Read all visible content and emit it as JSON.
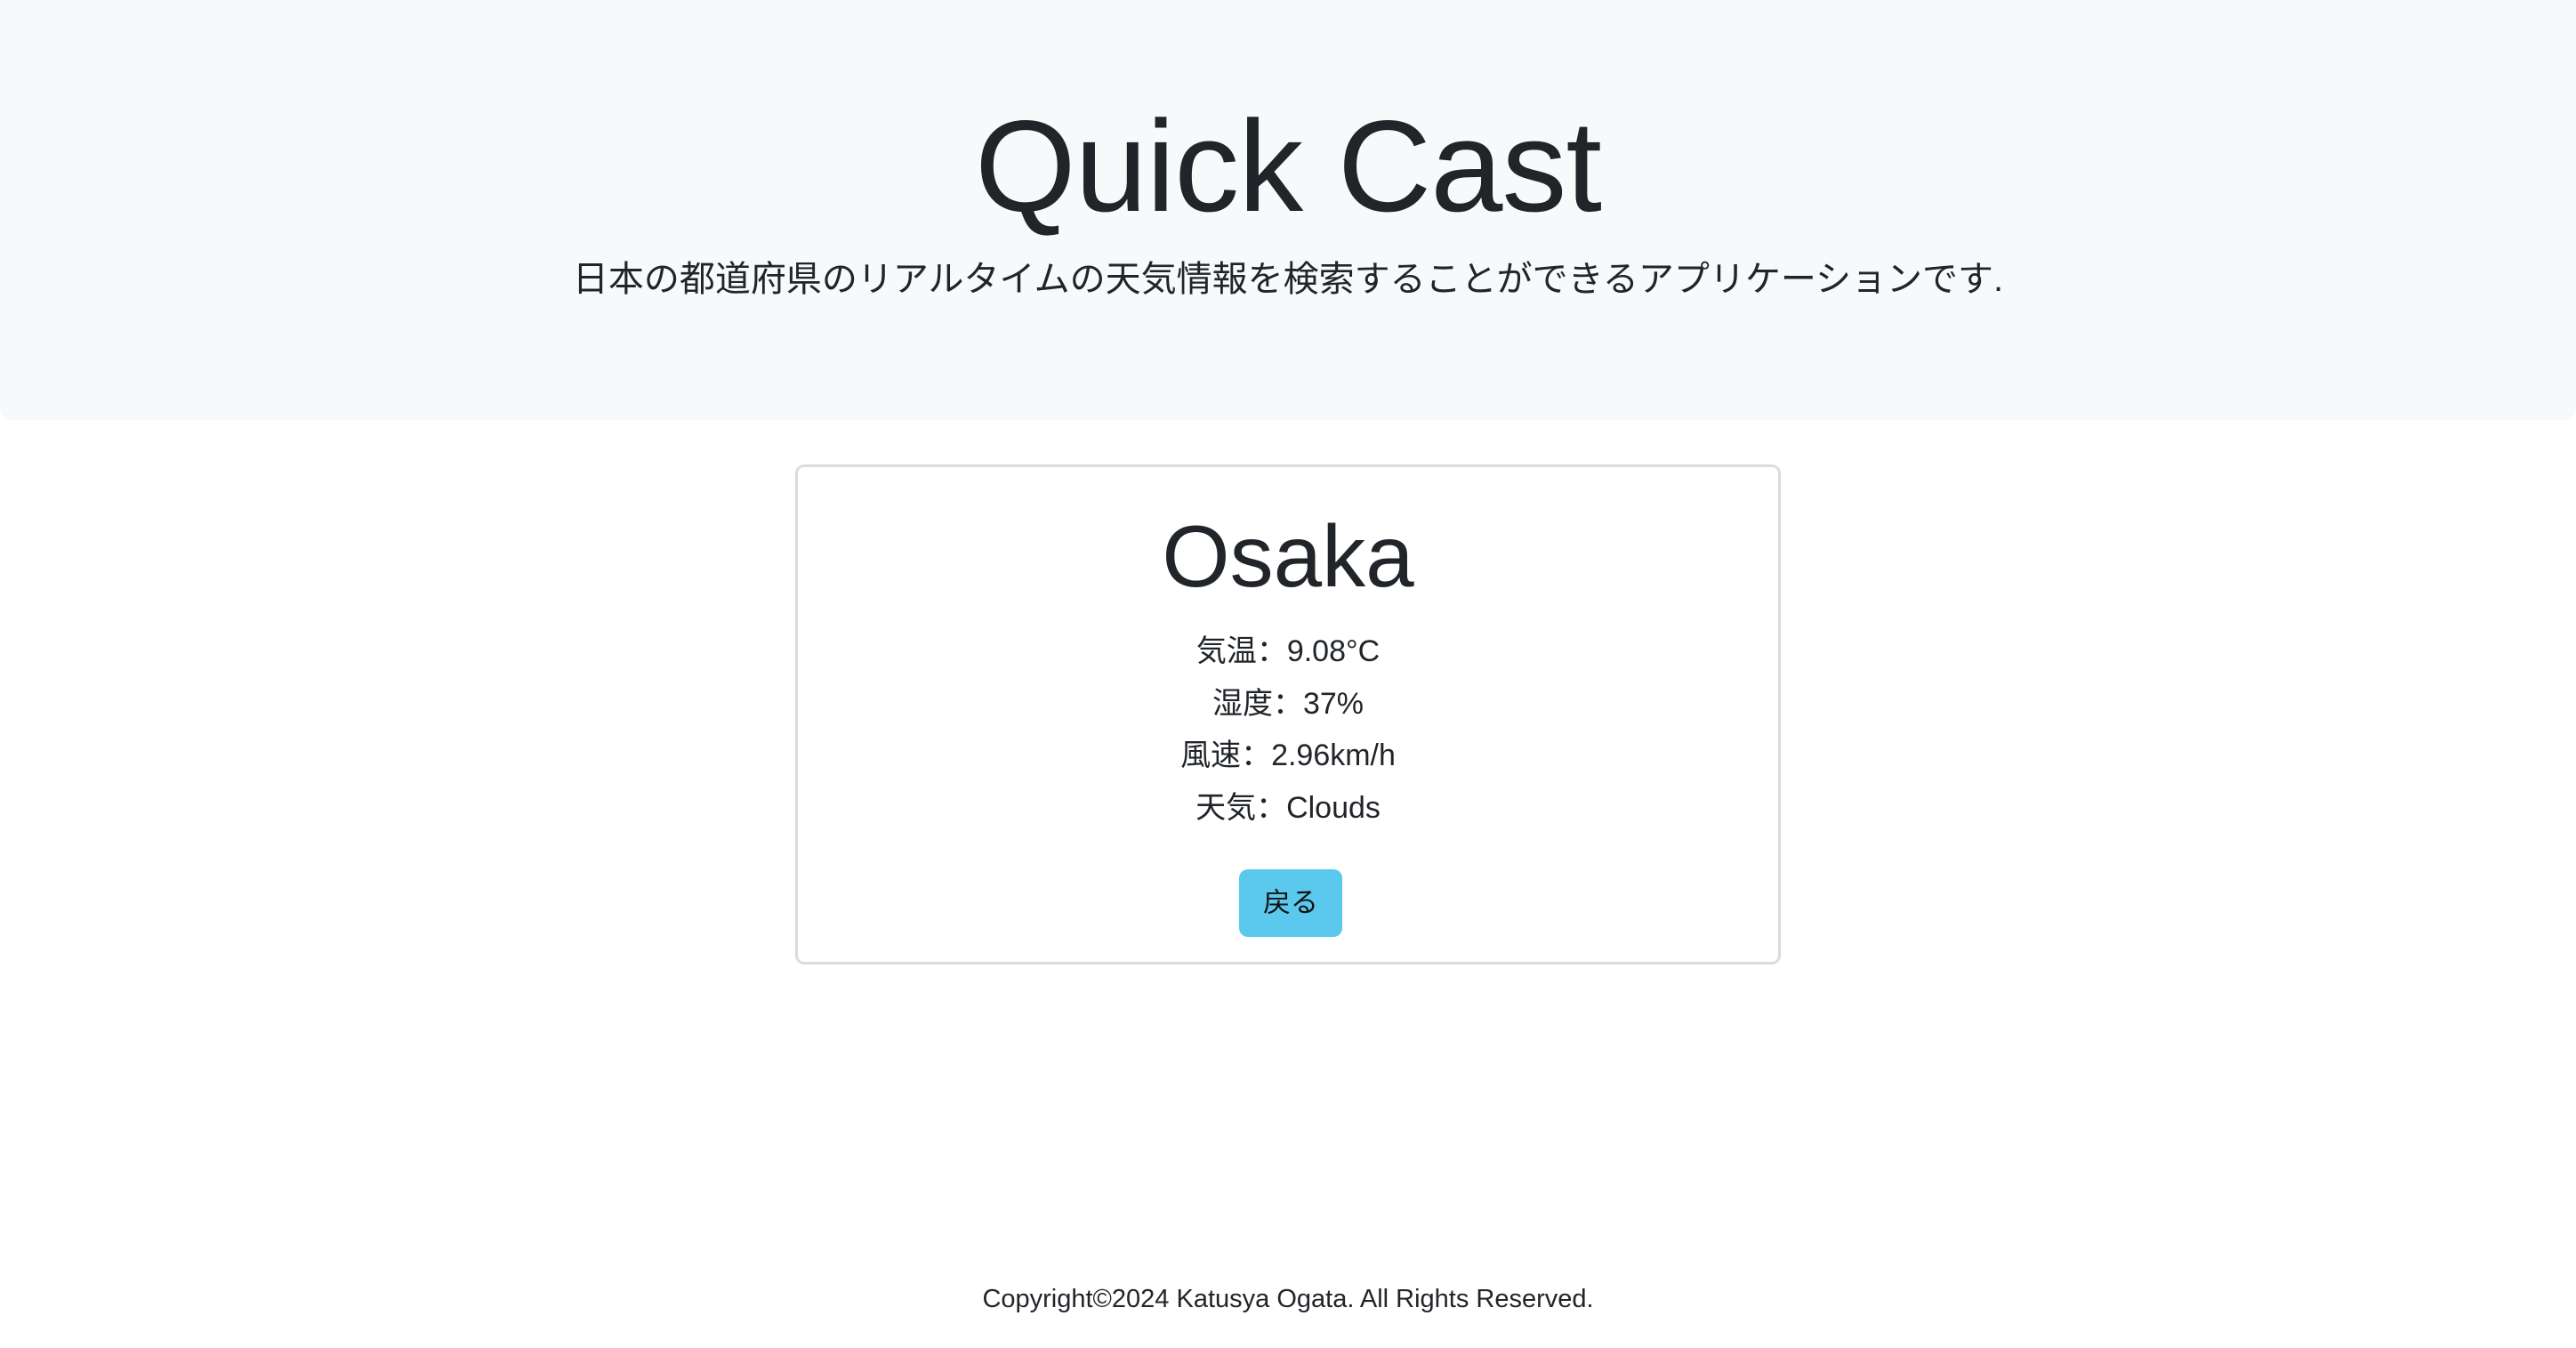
{
  "header": {
    "title": "Quick Cast",
    "lead": "日本の都道府県のリアルタイムの天気情報を検索することができるアプリケーションです."
  },
  "weather_card": {
    "city": "Osaka",
    "rows": [
      {
        "label": "気温",
        "separator": "：",
        "value": "9.08°C"
      },
      {
        "label": "湿度",
        "separator": "：",
        "value": "37%"
      },
      {
        "label": "風速",
        "separator": "：",
        "value": "2.96km/h"
      },
      {
        "label": "天気",
        "separator": "：",
        "value": "Clouds"
      }
    ],
    "back_button_label": "戻る"
  },
  "footer": {
    "copyright": "Copyright©2024 Katusya Ogata. All Rights Reserved."
  },
  "colors": {
    "hero_background": "#f8f9fa",
    "button_background": "#5bc8ed",
    "card_border": "#dcdcdc",
    "text": "#212529"
  }
}
